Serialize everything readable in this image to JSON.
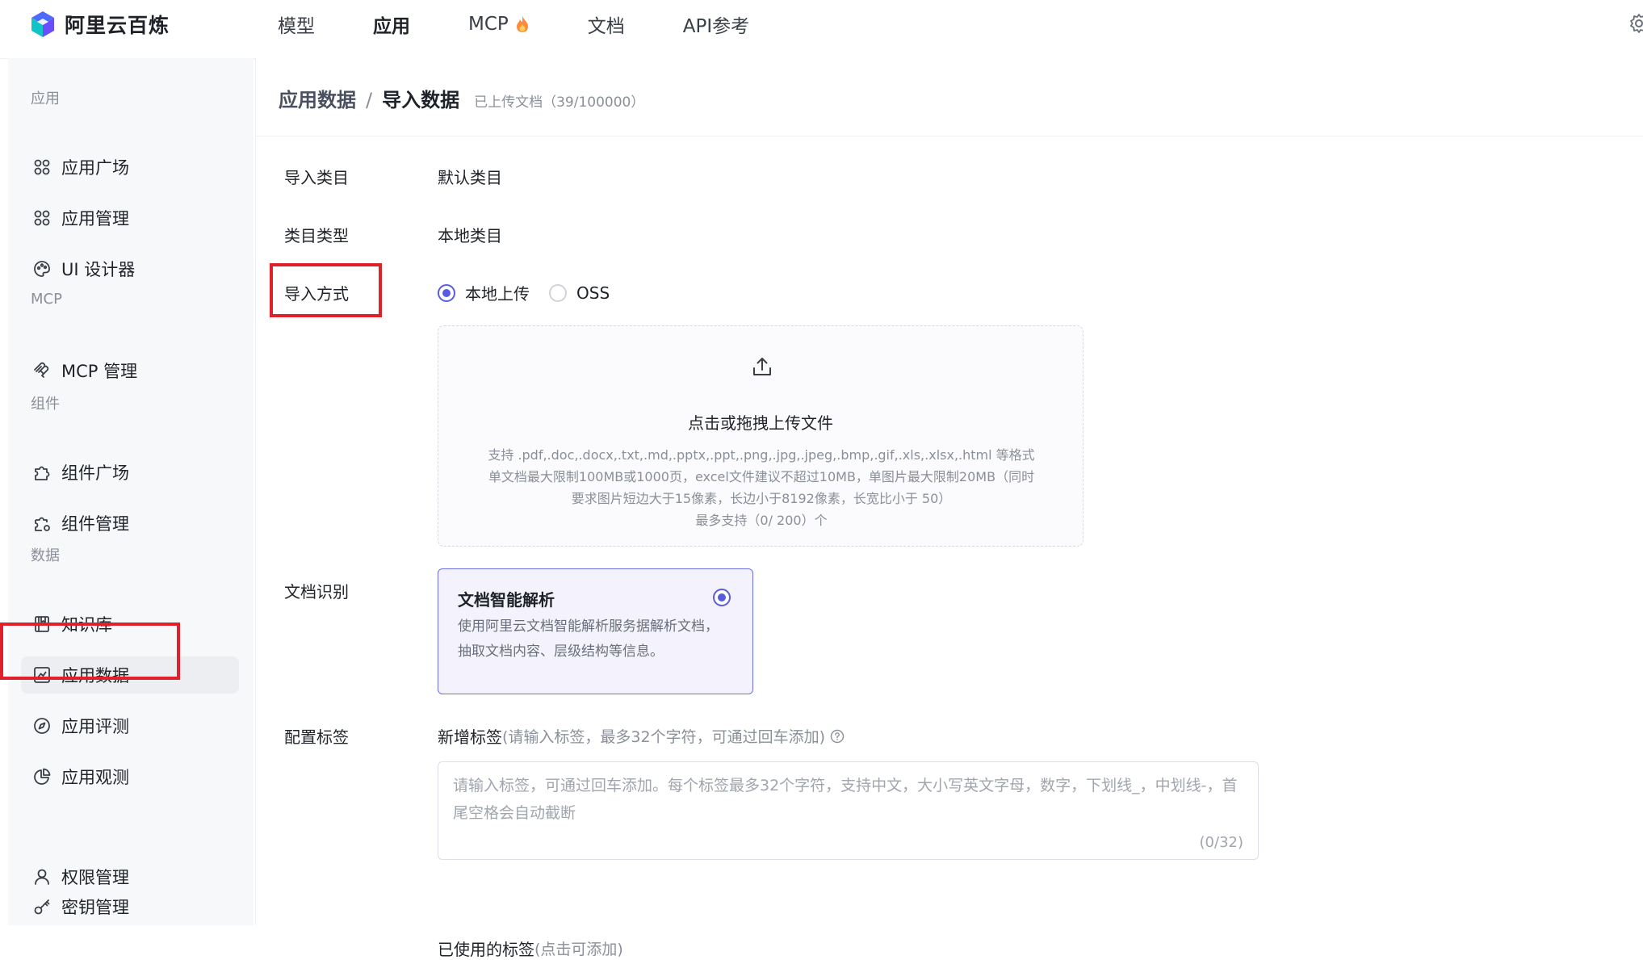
{
  "brand": {
    "name": "阿里云百炼"
  },
  "topnav": {
    "items": [
      {
        "label": "模型"
      },
      {
        "label": "应用"
      },
      {
        "label": "MCP"
      },
      {
        "label": "文档"
      },
      {
        "label": "API参考"
      }
    ],
    "active": "应用"
  },
  "sidebar": {
    "groups": [
      "应用",
      "MCP",
      "组件",
      "数据"
    ],
    "items": [
      {
        "label": "应用广场",
        "icon": "grid-icon"
      },
      {
        "label": "应用管理",
        "icon": "grid-icon"
      },
      {
        "label": "UI 设计器",
        "icon": "palette-icon"
      },
      {
        "label": "MCP 管理",
        "icon": "mcp-icon"
      },
      {
        "label": "组件广场",
        "icon": "puzzle-icon"
      },
      {
        "label": "组件管理",
        "icon": "puzzle-gear-icon"
      },
      {
        "label": "知识库",
        "icon": "book-icon"
      },
      {
        "label": "应用数据",
        "icon": "chart-icon"
      },
      {
        "label": "应用评测",
        "icon": "compass-icon"
      },
      {
        "label": "应用观测",
        "icon": "pie-icon"
      },
      {
        "label": "权限管理",
        "icon": "user-icon"
      },
      {
        "label": "密钥管理",
        "icon": "key-icon"
      }
    ],
    "active": "应用数据"
  },
  "breadcrumb": {
    "parent": "应用数据",
    "separator": "/",
    "current": "导入数据",
    "count": "已上传文档（39/100000）"
  },
  "form": {
    "category_label": "导入类目",
    "category_value": "默认类目",
    "type_label": "类目类型",
    "type_value": "本地类目",
    "method_label": "导入方式",
    "method_options": [
      "本地上传",
      "OSS"
    ],
    "method_selected": "本地上传",
    "upload": {
      "title": "点击或拖拽上传文件",
      "hint_lines": [
        "支持 .pdf,.doc,.docx,.txt,.md,.pptx,.ppt,.png,.jpg,.jpeg,.bmp,.gif,.xls,.xlsx,.html 等格式",
        "单文档最大限制100MB或1000页，excel文件建议不超过10MB，单图片最大限制20MB（同时",
        "要求图片短边大于15像素，长边小于8192像素，长宽比小于 50）",
        "最多支持（0/ 200）个"
      ]
    },
    "recognition_label": "文档识别",
    "recognition_card": {
      "title": "文档智能解析",
      "desc": "使用阿里云文档智能解析服务据解析文档，抽取文档内容、层级结构等信息。"
    },
    "tags_label": "配置标签",
    "new_tag": {
      "label": "新增标签",
      "hint": "(请输入标签，最多32个字符，可通过回车添加)"
    },
    "tag_input": {
      "placeholder": "请输入标签，可通过回车添加。每个标签最多32个字符，支持中文，大小写英文字母，数字，下划线_，中划线-，首尾空格会自动截断",
      "counter": "(0/32)"
    },
    "used_tags": {
      "label": "已使用的标签",
      "hint": "(点击可添加)"
    }
  },
  "colors": {
    "accent": "#5a5ce0",
    "highlight": "#e0202a",
    "sidebar_bg": "#f7f8fa"
  }
}
